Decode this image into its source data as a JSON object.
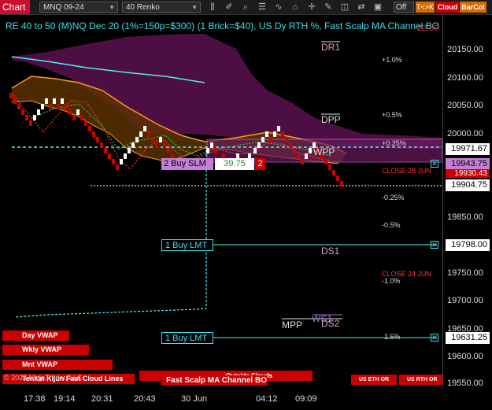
{
  "toolbar": {
    "chart_label": "Chart",
    "symbol": "MNQ 09-24",
    "bar_type": "40 Renko",
    "off_label": "Off",
    "tk_label": "T<>K",
    "cloud_label": "Cloud",
    "barcol_label": "BarCol",
    "accent": "#c8102e"
  },
  "chart_title": "RE 40 to 50 (M)NQ Dec 20 (1%=150p=$300) (1 Brick=$40), US Dy RTH %, Fast Scalp MA Channel BO",
  "red_value": "22.50",
  "y_ticks": [
    "20150.00",
    "20100.00",
    "20050.00",
    "20000.00",
    "19850.00",
    "19750.00",
    "19700.00",
    "19650.00",
    "19600.00",
    "19550.00"
  ],
  "price_tags": {
    "a": "19971.67",
    "b": "19943.75",
    "c": "19904.75",
    "d": "19798.00",
    "e": "19631.25"
  },
  "overlap_value": "19930.43",
  "x_ticks": [
    "17:38",
    "19:14",
    "20:31",
    "20:43",
    "30 Jun",
    "04:12",
    "09:09"
  ],
  "levels": {
    "dr1": "DR1",
    "dpp": "DPP",
    "wpp": "WPP",
    "ds1": "DS1",
    "mpp": "MPP",
    "ws1": "WS1",
    "ds2": "DS2"
  },
  "pct_labels": {
    "p1": "+1.0%",
    "p05": "+0.5%",
    "p025": "+0.25%",
    "m025": "-0.25%",
    "m05": "-0.5%",
    "m1": "-1.0%",
    "p15": "1.5%",
    "close28": "CLOSE 28 JUN",
    "close24": "CLOSE 24 JUN"
  },
  "orders": {
    "buy_slm": "2 Buy SLM",
    "buy_slm_price": "39.75",
    "buy_slm_qty": "2",
    "buy_lmt_1": "1 Buy LMT",
    "buy_lmt_2": "1 Buy LMT"
  },
  "bottom_buttons": {
    "day_vwap": "Day VWAP",
    "wkly_vwap": "Wkly VWAP",
    "mnt_vwap": "Mnt VWAP",
    "overlay_text": "© 2024 NinjaTrader, LLC",
    "tenkin": "Tenkin Kijun Fast Cloud Lines",
    "outside_clouds": "Outside Clouds",
    "fast_scalp": "Fast Scalp MA Channel BO",
    "us_eth_or": "US ETH OR",
    "us_rth_or": "US RTH OR"
  }
}
